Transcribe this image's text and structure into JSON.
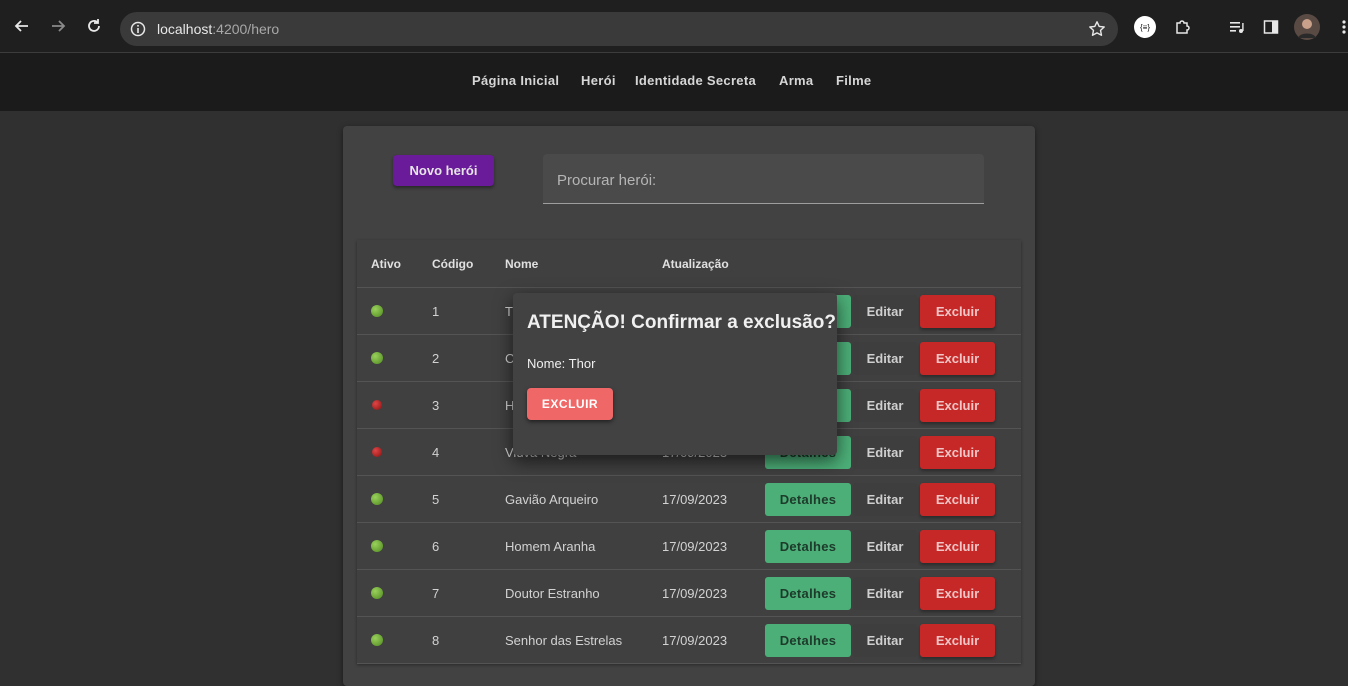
{
  "browser": {
    "url_host": "localhost",
    "url_rest": ":4200/hero"
  },
  "menu": [
    "Página Inicial",
    "Herói",
    "Identidade Secreta",
    "Arma",
    "Filme"
  ],
  "toolbar": {
    "new_hero_label": "Novo herói",
    "search_placeholder": "Procurar herói:"
  },
  "table": {
    "headers": [
      "Ativo",
      "Código",
      "Nome",
      "Atualização"
    ],
    "rows": [
      {
        "active": true,
        "code": "1",
        "name": "T",
        "date": ""
      },
      {
        "active": true,
        "code": "2",
        "name": "C",
        "date": ""
      },
      {
        "active": false,
        "code": "3",
        "name": "H",
        "date": ""
      },
      {
        "active": false,
        "code": "4",
        "name": "Viúva Negra",
        "date": "17/09/2023"
      },
      {
        "active": true,
        "code": "5",
        "name": "Gavião Arqueiro",
        "date": "17/09/2023"
      },
      {
        "active": true,
        "code": "6",
        "name": "Homem Aranha",
        "date": "17/09/2023"
      },
      {
        "active": true,
        "code": "7",
        "name": "Doutor Estranho",
        "date": "17/09/2023"
      },
      {
        "active": true,
        "code": "8",
        "name": "Senhor das Estrelas",
        "date": "17/09/2023"
      }
    ],
    "details_label": "Detalhes",
    "edit_label": "Editar",
    "delete_label": "Excluir"
  },
  "dialog": {
    "title": "ATENÇÃO! Confirmar a exclusão?",
    "body": "Nome: Thor",
    "confirm_label": "EXCLUIR"
  },
  "colors": {
    "primary": "#6a1b9a",
    "success": "#4caf78",
    "danger": "#c62828",
    "dialog_button": "#f06767"
  }
}
